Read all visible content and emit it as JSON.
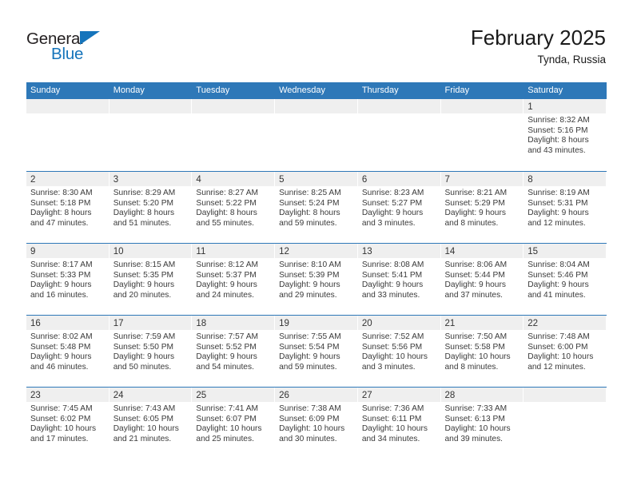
{
  "brand": {
    "name_part1": "General",
    "name_part2": "Blue"
  },
  "header": {
    "title": "February 2025",
    "location": "Tynda, Russia"
  },
  "colors": {
    "header_blue": "#2e78b8",
    "brand_blue": "#1574bb",
    "day_band_gray": "#efefef",
    "text": "#1a1a1a"
  },
  "weekdays": [
    "Sunday",
    "Monday",
    "Tuesday",
    "Wednesday",
    "Thursday",
    "Friday",
    "Saturday"
  ],
  "weeks": [
    [
      {
        "day": "",
        "empty": true
      },
      {
        "day": "",
        "empty": true
      },
      {
        "day": "",
        "empty": true
      },
      {
        "day": "",
        "empty": true
      },
      {
        "day": "",
        "empty": true
      },
      {
        "day": "",
        "empty": true
      },
      {
        "day": "1",
        "sunrise": "Sunrise: 8:32 AM",
        "sunset": "Sunset: 5:16 PM",
        "daylight1": "Daylight: 8 hours",
        "daylight2": "and 43 minutes."
      }
    ],
    [
      {
        "day": "2",
        "sunrise": "Sunrise: 8:30 AM",
        "sunset": "Sunset: 5:18 PM",
        "daylight1": "Daylight: 8 hours",
        "daylight2": "and 47 minutes."
      },
      {
        "day": "3",
        "sunrise": "Sunrise: 8:29 AM",
        "sunset": "Sunset: 5:20 PM",
        "daylight1": "Daylight: 8 hours",
        "daylight2": "and 51 minutes."
      },
      {
        "day": "4",
        "sunrise": "Sunrise: 8:27 AM",
        "sunset": "Sunset: 5:22 PM",
        "daylight1": "Daylight: 8 hours",
        "daylight2": "and 55 minutes."
      },
      {
        "day": "5",
        "sunrise": "Sunrise: 8:25 AM",
        "sunset": "Sunset: 5:24 PM",
        "daylight1": "Daylight: 8 hours",
        "daylight2": "and 59 minutes."
      },
      {
        "day": "6",
        "sunrise": "Sunrise: 8:23 AM",
        "sunset": "Sunset: 5:27 PM",
        "daylight1": "Daylight: 9 hours",
        "daylight2": "and 3 minutes."
      },
      {
        "day": "7",
        "sunrise": "Sunrise: 8:21 AM",
        "sunset": "Sunset: 5:29 PM",
        "daylight1": "Daylight: 9 hours",
        "daylight2": "and 8 minutes."
      },
      {
        "day": "8",
        "sunrise": "Sunrise: 8:19 AM",
        "sunset": "Sunset: 5:31 PM",
        "daylight1": "Daylight: 9 hours",
        "daylight2": "and 12 minutes."
      }
    ],
    [
      {
        "day": "9",
        "sunrise": "Sunrise: 8:17 AM",
        "sunset": "Sunset: 5:33 PM",
        "daylight1": "Daylight: 9 hours",
        "daylight2": "and 16 minutes."
      },
      {
        "day": "10",
        "sunrise": "Sunrise: 8:15 AM",
        "sunset": "Sunset: 5:35 PM",
        "daylight1": "Daylight: 9 hours",
        "daylight2": "and 20 minutes."
      },
      {
        "day": "11",
        "sunrise": "Sunrise: 8:12 AM",
        "sunset": "Sunset: 5:37 PM",
        "daylight1": "Daylight: 9 hours",
        "daylight2": "and 24 minutes."
      },
      {
        "day": "12",
        "sunrise": "Sunrise: 8:10 AM",
        "sunset": "Sunset: 5:39 PM",
        "daylight1": "Daylight: 9 hours",
        "daylight2": "and 29 minutes."
      },
      {
        "day": "13",
        "sunrise": "Sunrise: 8:08 AM",
        "sunset": "Sunset: 5:41 PM",
        "daylight1": "Daylight: 9 hours",
        "daylight2": "and 33 minutes."
      },
      {
        "day": "14",
        "sunrise": "Sunrise: 8:06 AM",
        "sunset": "Sunset: 5:44 PM",
        "daylight1": "Daylight: 9 hours",
        "daylight2": "and 37 minutes."
      },
      {
        "day": "15",
        "sunrise": "Sunrise: 8:04 AM",
        "sunset": "Sunset: 5:46 PM",
        "daylight1": "Daylight: 9 hours",
        "daylight2": "and 41 minutes."
      }
    ],
    [
      {
        "day": "16",
        "sunrise": "Sunrise: 8:02 AM",
        "sunset": "Sunset: 5:48 PM",
        "daylight1": "Daylight: 9 hours",
        "daylight2": "and 46 minutes."
      },
      {
        "day": "17",
        "sunrise": "Sunrise: 7:59 AM",
        "sunset": "Sunset: 5:50 PM",
        "daylight1": "Daylight: 9 hours",
        "daylight2": "and 50 minutes."
      },
      {
        "day": "18",
        "sunrise": "Sunrise: 7:57 AM",
        "sunset": "Sunset: 5:52 PM",
        "daylight1": "Daylight: 9 hours",
        "daylight2": "and 54 minutes."
      },
      {
        "day": "19",
        "sunrise": "Sunrise: 7:55 AM",
        "sunset": "Sunset: 5:54 PM",
        "daylight1": "Daylight: 9 hours",
        "daylight2": "and 59 minutes."
      },
      {
        "day": "20",
        "sunrise": "Sunrise: 7:52 AM",
        "sunset": "Sunset: 5:56 PM",
        "daylight1": "Daylight: 10 hours",
        "daylight2": "and 3 minutes."
      },
      {
        "day": "21",
        "sunrise": "Sunrise: 7:50 AM",
        "sunset": "Sunset: 5:58 PM",
        "daylight1": "Daylight: 10 hours",
        "daylight2": "and 8 minutes."
      },
      {
        "day": "22",
        "sunrise": "Sunrise: 7:48 AM",
        "sunset": "Sunset: 6:00 PM",
        "daylight1": "Daylight: 10 hours",
        "daylight2": "and 12 minutes."
      }
    ],
    [
      {
        "day": "23",
        "sunrise": "Sunrise: 7:45 AM",
        "sunset": "Sunset: 6:02 PM",
        "daylight1": "Daylight: 10 hours",
        "daylight2": "and 17 minutes."
      },
      {
        "day": "24",
        "sunrise": "Sunrise: 7:43 AM",
        "sunset": "Sunset: 6:05 PM",
        "daylight1": "Daylight: 10 hours",
        "daylight2": "and 21 minutes."
      },
      {
        "day": "25",
        "sunrise": "Sunrise: 7:41 AM",
        "sunset": "Sunset: 6:07 PM",
        "daylight1": "Daylight: 10 hours",
        "daylight2": "and 25 minutes."
      },
      {
        "day": "26",
        "sunrise": "Sunrise: 7:38 AM",
        "sunset": "Sunset: 6:09 PM",
        "daylight1": "Daylight: 10 hours",
        "daylight2": "and 30 minutes."
      },
      {
        "day": "27",
        "sunrise": "Sunrise: 7:36 AM",
        "sunset": "Sunset: 6:11 PM",
        "daylight1": "Daylight: 10 hours",
        "daylight2": "and 34 minutes."
      },
      {
        "day": "28",
        "sunrise": "Sunrise: 7:33 AM",
        "sunset": "Sunset: 6:13 PM",
        "daylight1": "Daylight: 10 hours",
        "daylight2": "and 39 minutes."
      },
      {
        "day": "",
        "empty": true
      }
    ]
  ]
}
